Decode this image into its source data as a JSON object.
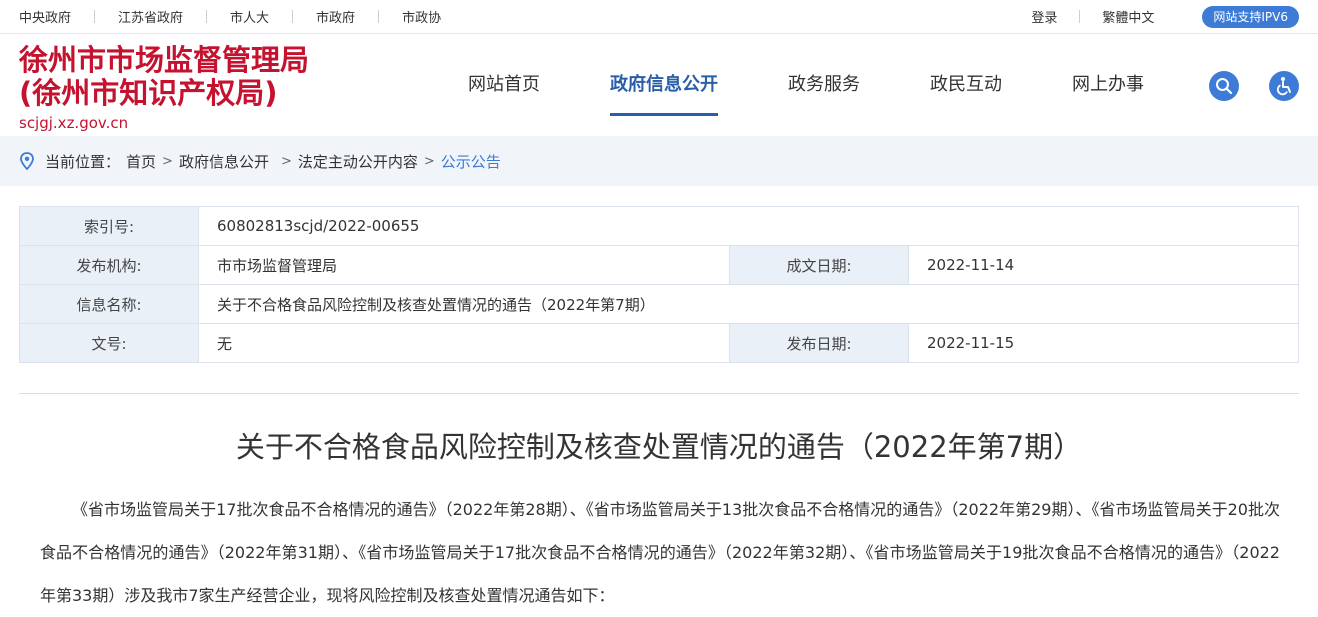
{
  "topbar": {
    "links": [
      "中央政府",
      "江苏省政府",
      "市人大",
      "市政府",
      "市政协"
    ],
    "login": "登录",
    "traditional": "繁體中文",
    "ipv6": "网站支持IPV6"
  },
  "header": {
    "logo_line1": "徐州市市场监督管理局",
    "logo_line2": "(徐州市知识产权局)",
    "logo_url": "scjgj.xz.gov.cn",
    "nav": [
      "网站首页",
      "政府信息公开",
      "政务服务",
      "政民互动",
      "网上办事"
    ],
    "active_nav": "政府信息公开",
    "search_icon": "search-icon",
    "accessibility_icon": "accessibility-icon"
  },
  "breadcrumb": {
    "label": "当前位置：",
    "items": [
      "首页",
      "政府信息公开",
      "法定主动公开内容"
    ],
    "current": "公示公告"
  },
  "meta": {
    "index_label": "索引号:",
    "index_value": "60802813scjd/2022-00655",
    "org_label": "发布机构:",
    "org_value": "市市场监督管理局",
    "created_label": "成文日期:",
    "created_value": "2022-11-14",
    "name_label": "信息名称:",
    "name_value": "关于不合格食品风险控制及核查处置情况的通告（2022年第7期）",
    "docno_label": "文号:",
    "docno_value": "无",
    "published_label": "发布日期:",
    "published_value": "2022-11-15"
  },
  "article": {
    "title": "关于不合格食品风险控制及核查处置情况的通告（2022年第7期）",
    "paragraph": "《省市场监管局关于17批次食品不合格情况的通告》（2022年第28期）、《省市场监管局关于13批次食品不合格情况的通告》（2022年第29期）、《省市场监管局关于20批次食品不合格情况的通告》（2022年第31期）、《省市场监管局关于17批次食品不合格情况的通告》（2022年第32期）、《省市场监管局关于19批次食品不合格情况的通告》（2022年第33期）涉及我市7家生产经营企业，现将风险控制及核查处置情况通告如下："
  },
  "colors": {
    "brand_red": "#c4122f",
    "accent_blue": "#3d7bd6",
    "nav_active": "#2a5ea8"
  }
}
